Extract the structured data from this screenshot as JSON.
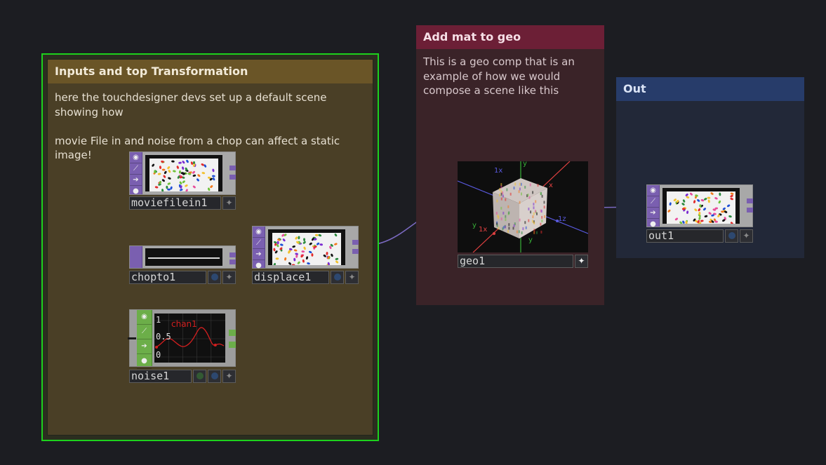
{
  "boxes": {
    "inputs": {
      "title": "Inputs and top Transformation",
      "text": "here the touchdesigner devs set up a default scene showing how\n\nmovie File in and noise from a chop can affect a static image!"
    },
    "mat": {
      "title": "Add mat to geo",
      "text": "This is a geo comp that is an example of how we would compose a scene like this"
    },
    "out": {
      "title": "Out"
    }
  },
  "operators": {
    "moviefilein": {
      "name": "moviefilein1",
      "family": "TOP"
    },
    "chopto": {
      "name": "chopto1",
      "family": "TOP"
    },
    "displace": {
      "name": "displace1",
      "family": "TOP"
    },
    "noise": {
      "name": "noise1",
      "family": "CHOP"
    },
    "geo": {
      "name": "geo1",
      "family": "COMP"
    },
    "out": {
      "name": "out1",
      "family": "TOP"
    }
  },
  "noise_viewer": {
    "channel": "chan1",
    "ticks": [
      "1",
      "0.5",
      "0"
    ]
  },
  "geo_viewer": {
    "axis_labels": [
      "y",
      "x",
      "1x",
      "y",
      "1z",
      "y",
      "1x"
    ]
  },
  "colors": {
    "top_family": "#7a5fb0",
    "chop_family": "#6cae49",
    "wire": "#7a69c0",
    "inputs_border": "#1dd11d",
    "inputs_header": "#6a5527",
    "mat_header": "#6c1f36",
    "out_header": "#273c6a"
  },
  "icons": {
    "side_buttons": [
      "viewer-toggle-icon",
      "cook-icon",
      "bypass-icon",
      "lock-icon"
    ],
    "flag_buttons": [
      "display-flag-icon",
      "render-flag-icon",
      "clone-icon"
    ]
  }
}
